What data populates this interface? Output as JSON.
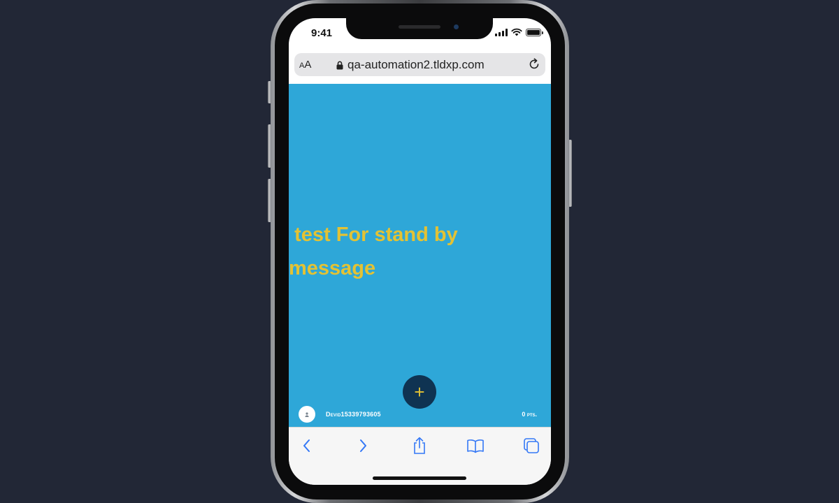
{
  "status_bar": {
    "time": "9:41"
  },
  "browser": {
    "text_size_label_small": "A",
    "text_size_label_large": "A",
    "url": "qa-automation2.tldxp.com"
  },
  "page": {
    "background_color": "#2ea7d8",
    "standby_message": " test For stand by message",
    "fab_label": "+",
    "user": {
      "username": "Devid15339793605",
      "points": "0 pts."
    }
  },
  "toolbar": {
    "icons": [
      "back-icon",
      "forward-icon",
      "share-icon",
      "bookmarks-icon",
      "tabs-icon"
    ]
  },
  "colors": {
    "accent": "#e3c234",
    "fab_background": "#0f3352",
    "tint": "#3478f6"
  }
}
